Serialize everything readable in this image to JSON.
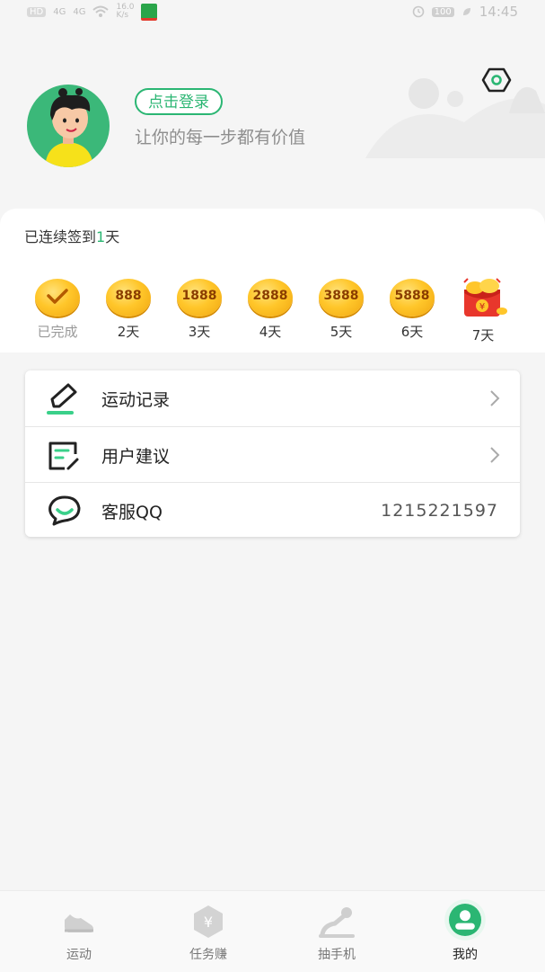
{
  "status_bar": {
    "carrier_badge": "HD",
    "signal_1": "4G",
    "signal_2": "4G",
    "speed": "16.0 K/s",
    "battery": "100",
    "time": "14:45"
  },
  "header": {
    "login_label": "点击登录",
    "slogan": "让你的每一步都有价值",
    "settings_icon": "settings-hex-icon"
  },
  "signin": {
    "title_prefix": "已连续签到",
    "streak": "1",
    "title_suffix": "天",
    "days": [
      {
        "amount": "",
        "label": "已完成",
        "done": true
      },
      {
        "amount": "888",
        "label": "2天"
      },
      {
        "amount": "1888",
        "label": "3天"
      },
      {
        "amount": "2888",
        "label": "4天"
      },
      {
        "amount": "3888",
        "label": "5天"
      },
      {
        "amount": "5888",
        "label": "6天"
      },
      {
        "amount": "",
        "label": "7天",
        "gift": true
      }
    ]
  },
  "menu": {
    "items": [
      {
        "label": "运动记录",
        "icon": "pencil-icon"
      },
      {
        "label": "用户建议",
        "icon": "feedback-icon"
      },
      {
        "label": "客服QQ",
        "icon": "chat-icon",
        "value": "1215221597"
      }
    ]
  },
  "tabbar": {
    "tabs": [
      {
        "label": "运动",
        "icon": "shoe-icon"
      },
      {
        "label": "任务赚",
        "icon": "yuan-hex-icon"
      },
      {
        "label": "抽手机",
        "icon": "joystick-icon"
      },
      {
        "label": "我的",
        "icon": "profile-icon",
        "active": true
      }
    ]
  },
  "colors": {
    "accent": "#2bb673",
    "coin": "#ffc62a",
    "background": "#f5f5f5"
  }
}
